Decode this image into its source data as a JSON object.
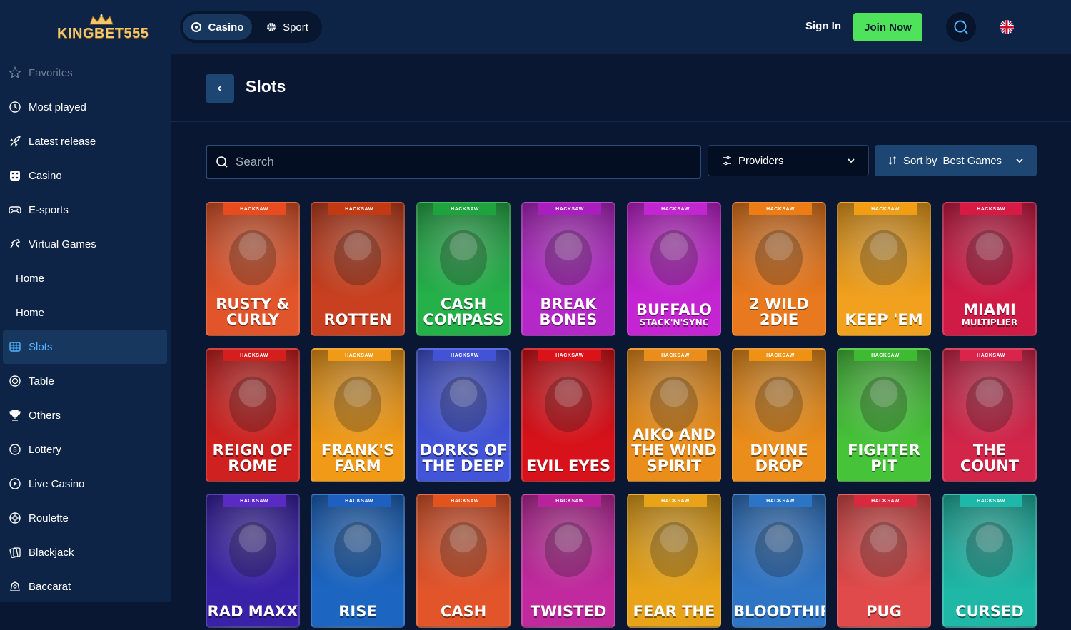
{
  "header": {
    "brand": "KINGBET555",
    "modes": [
      {
        "label": "Casino"
      },
      {
        "label": "Sport"
      }
    ],
    "sign_in": "Sign In",
    "join": "Join Now"
  },
  "sidebar": {
    "items": [
      {
        "label": "Favorites",
        "icon": "star-icon"
      },
      {
        "label": "Most played",
        "icon": "clock-icon"
      },
      {
        "label": "Latest release",
        "icon": "rocket-icon"
      },
      {
        "label": "Casino",
        "icon": "dice-icon"
      },
      {
        "label": "E-sports",
        "icon": "gamepad-icon"
      },
      {
        "label": "Virtual Games",
        "icon": "horse-icon"
      },
      {
        "label": "Home",
        "icon": ""
      },
      {
        "label": "Home",
        "icon": ""
      },
      {
        "label": "Slots",
        "icon": "slots-icon"
      },
      {
        "label": "Table",
        "icon": "chip-icon"
      },
      {
        "label": "Others",
        "icon": "trophy-icon"
      },
      {
        "label": "Lottery",
        "icon": "lottery-icon"
      },
      {
        "label": "Live Casino",
        "icon": "play-icon"
      },
      {
        "label": "Roulette",
        "icon": "roulette-icon"
      },
      {
        "label": "Blackjack",
        "icon": "cards-icon"
      },
      {
        "label": "Baccarat",
        "icon": "baccarat-icon"
      }
    ]
  },
  "page": {
    "title": "Slots",
    "search_placeholder": "Search",
    "providers_label": "Providers",
    "sort_label": "Sort by",
    "sort_value": "Best Games"
  },
  "games": [
    {
      "title": "RUSTY & CURLY",
      "provider": "HACKSAW",
      "bg": "#e2552b",
      "tag": "#e84b1d"
    },
    {
      "title": "ROTTEN",
      "provider": "HACKSAW",
      "bg": "#c8401f",
      "tag": "#c23a14"
    },
    {
      "title": "CASH COMPASS",
      "provider": "HACKSAW",
      "bg": "#25b14a",
      "tag": "#1fa33f"
    },
    {
      "title": "BREAK BONES",
      "provider": "HACKSAW",
      "bg": "#b428c8",
      "tag": "#a81fbd"
    },
    {
      "title": "BUFFALO",
      "subtitle": "STACK'N'SYNC",
      "provider": "HACKSAW",
      "bg": "#c524d2",
      "tag": "#c226d0"
    },
    {
      "title": "2 WILD 2DIE",
      "provider": "HACKSAW",
      "bg": "#e9791e",
      "tag": "#ee7c15"
    },
    {
      "title": "KEEP 'EM",
      "provider": "HACKSAW",
      "bg": "#f1a11d",
      "tag": "#f29e14"
    },
    {
      "title": "MIAMI",
      "subtitle": "MULTIPLIER",
      "provider": "HACKSAW",
      "bg": "#d11b47",
      "tag": "#d71a43"
    },
    {
      "title": "REIGN OF ROME",
      "provider": "HACKSAW",
      "bg": "#cf2220",
      "tag": "#d41f1c"
    },
    {
      "title": "FRANK'S FARM",
      "provider": "HACKSAW",
      "bg": "#f09a18",
      "tag": "#f09a18"
    },
    {
      "title": "DORKS OF THE DEEP",
      "provider": "HACKSAW",
      "bg": "#4254d8",
      "tag": "#4353d6"
    },
    {
      "title": "EVIL EYES",
      "provider": "HACKSAW",
      "bg": "#d8121a",
      "tag": "#dc1219"
    },
    {
      "title": "AIKO AND THE WIND SPIRIT",
      "provider": "HACKSAW",
      "bg": "#ea8d1a",
      "tag": "#eb8d1a"
    },
    {
      "title": "DIVINE DROP",
      "provider": "HACKSAW",
      "bg": "#ea8d1a",
      "tag": "#ef9214"
    },
    {
      "title": "FIGHTER PIT",
      "provider": "HACKSAW",
      "bg": "#47c33a",
      "tag": "#3fbb33"
    },
    {
      "title": "THE COUNT",
      "provider": "HACKSAW",
      "bg": "#d3254a",
      "tag": "#d9244b"
    },
    {
      "title": "RAD MAXX",
      "provider": "HACKSAW",
      "bg": "#3a22a8",
      "tag": "#5a2bc4"
    },
    {
      "title": "RISE",
      "provider": "HACKSAW",
      "bg": "#1c66c2",
      "tag": "#1f5fc0"
    },
    {
      "title": "CASH",
      "provider": "HACKSAW",
      "bg": "#e2552b",
      "tag": "#e1541e"
    },
    {
      "title": "TWISTED",
      "provider": "HACKSAW",
      "bg": "#c12a9e",
      "tag": "#b8229c"
    },
    {
      "title": "FEAR THE",
      "provider": "HACKSAW",
      "bg": "#e8a319",
      "tag": "#e8a318"
    },
    {
      "title": "BLOODTHIRST",
      "provider": "HACKSAW",
      "bg": "#2f75c6",
      "tag": "#2b74c6"
    },
    {
      "title": "PUG",
      "provider": "HACKSAW",
      "bg": "#e04a4a",
      "tag": "#d9293f"
    },
    {
      "title": "CURSED",
      "provider": "HACKSAW",
      "bg": "#1fb7a6",
      "tag": "#1db8a8"
    }
  ],
  "colors": {
    "background": "#0a1733",
    "panel": "#0e2447",
    "accent": "#4fb5ff",
    "join": "#4fe35c",
    "brand_gold": "#f3c76b"
  }
}
